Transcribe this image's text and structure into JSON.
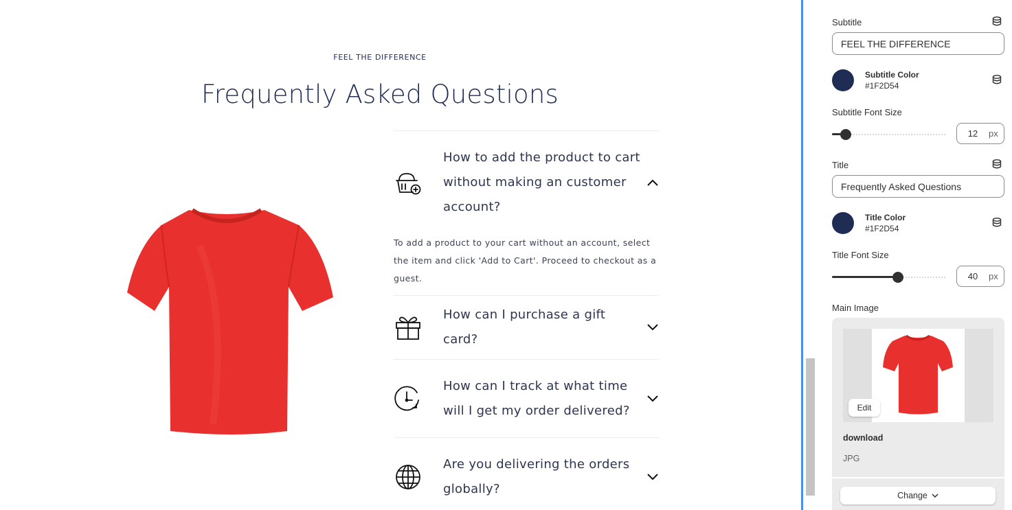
{
  "preview": {
    "subtitle": "FEEL THE DIFFERENCE",
    "title": "Frequently Asked Questions",
    "faq": [
      {
        "icon": "basket-add-icon",
        "question": "How to add the product to cart without making an customer account?",
        "expanded": true,
        "answer": "To add a product to your cart without an account, select the item and click 'Add to Cart'. Proceed to checkout as a guest."
      },
      {
        "icon": "gift-icon",
        "question": "How can I purchase a gift card?",
        "expanded": false
      },
      {
        "icon": "clock-refresh-icon",
        "question": "How can I track at what time will I get my order delivered?",
        "expanded": false
      },
      {
        "icon": "globe-icon",
        "question": "Are you delivering the orders globally?",
        "expanded": false
      }
    ]
  },
  "settings": {
    "subtitle": {
      "label": "Subtitle",
      "value": "FEEL THE DIFFERENCE"
    },
    "subtitle_color": {
      "label": "Subtitle Color",
      "hex": "#1F2D54"
    },
    "subtitle_font_size": {
      "label": "Subtitle Font Size",
      "value": "12",
      "unit": "px",
      "level": 0.08
    },
    "title": {
      "label": "Title",
      "value": "Frequently Asked Questions"
    },
    "title_color": {
      "label": "Title Color",
      "hex": "#1F2D54"
    },
    "title_font_size": {
      "label": "Title Font Size",
      "value": "40",
      "unit": "px",
      "level": 0.59
    },
    "main_image": {
      "label": "Main Image",
      "edit_label": "Edit",
      "file_name": "download",
      "file_type": "JPG",
      "change_label": "Change"
    }
  },
  "colors": {
    "brand": "#1F2D54",
    "divider_accent": "#4A8FF0",
    "tshirt": "#E8302E"
  }
}
